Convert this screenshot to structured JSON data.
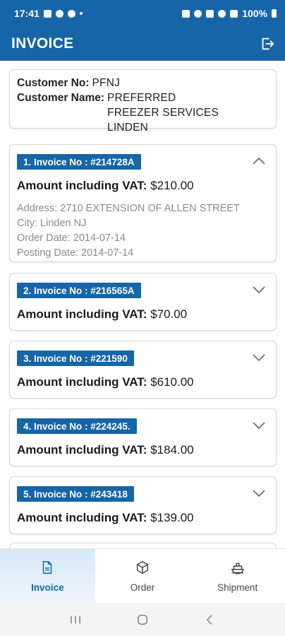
{
  "status_bar": {
    "time": "17:41",
    "battery": "100%"
  },
  "app_bar": {
    "title": "INVOICE",
    "logout_icon": "logout-icon"
  },
  "customer": {
    "no_label": "Customer No:",
    "no_value": "PFNJ",
    "name_label": "Customer Name:",
    "name_value": "PREFERRED FREEZER SERVICES LINDEN"
  },
  "invoices": [
    {
      "badge": "1. Invoice No : #214728A",
      "amount_label": "Amount including VAT:",
      "amount": "$210.00",
      "expanded": true,
      "address": "Address: 2710 EXTENSION OF ALLEN STREET",
      "city": "City: Linden NJ",
      "order_date": "Order Date: 2014-07-14",
      "posting_date": "Posting Date: 2014-07-14"
    },
    {
      "badge": "2. Invoice No : #216565A",
      "amount_label": "Amount including VAT:",
      "amount": "$70.00",
      "expanded": false
    },
    {
      "badge": "3. Invoice No : #221590",
      "amount_label": "Amount including VAT:",
      "amount": "$610.00",
      "expanded": false
    },
    {
      "badge": "4. Invoice No : #224245.",
      "amount_label": "Amount including VAT:",
      "amount": "$184.00",
      "expanded": false
    },
    {
      "badge": "5. Invoice No : #243418",
      "amount_label": "Amount including VAT:",
      "amount": "$139.00",
      "expanded": false
    }
  ],
  "bottom_nav": [
    {
      "label": "Invoice",
      "icon": "document-icon",
      "active": true
    },
    {
      "label": "Order",
      "icon": "box-icon",
      "active": false
    },
    {
      "label": "Shipment",
      "icon": "ship-icon",
      "active": false
    }
  ],
  "colors": {
    "primary": "#1565a8",
    "muted_text": "#8a8a8a",
    "nav_active_bg": "#d7e8f6"
  }
}
